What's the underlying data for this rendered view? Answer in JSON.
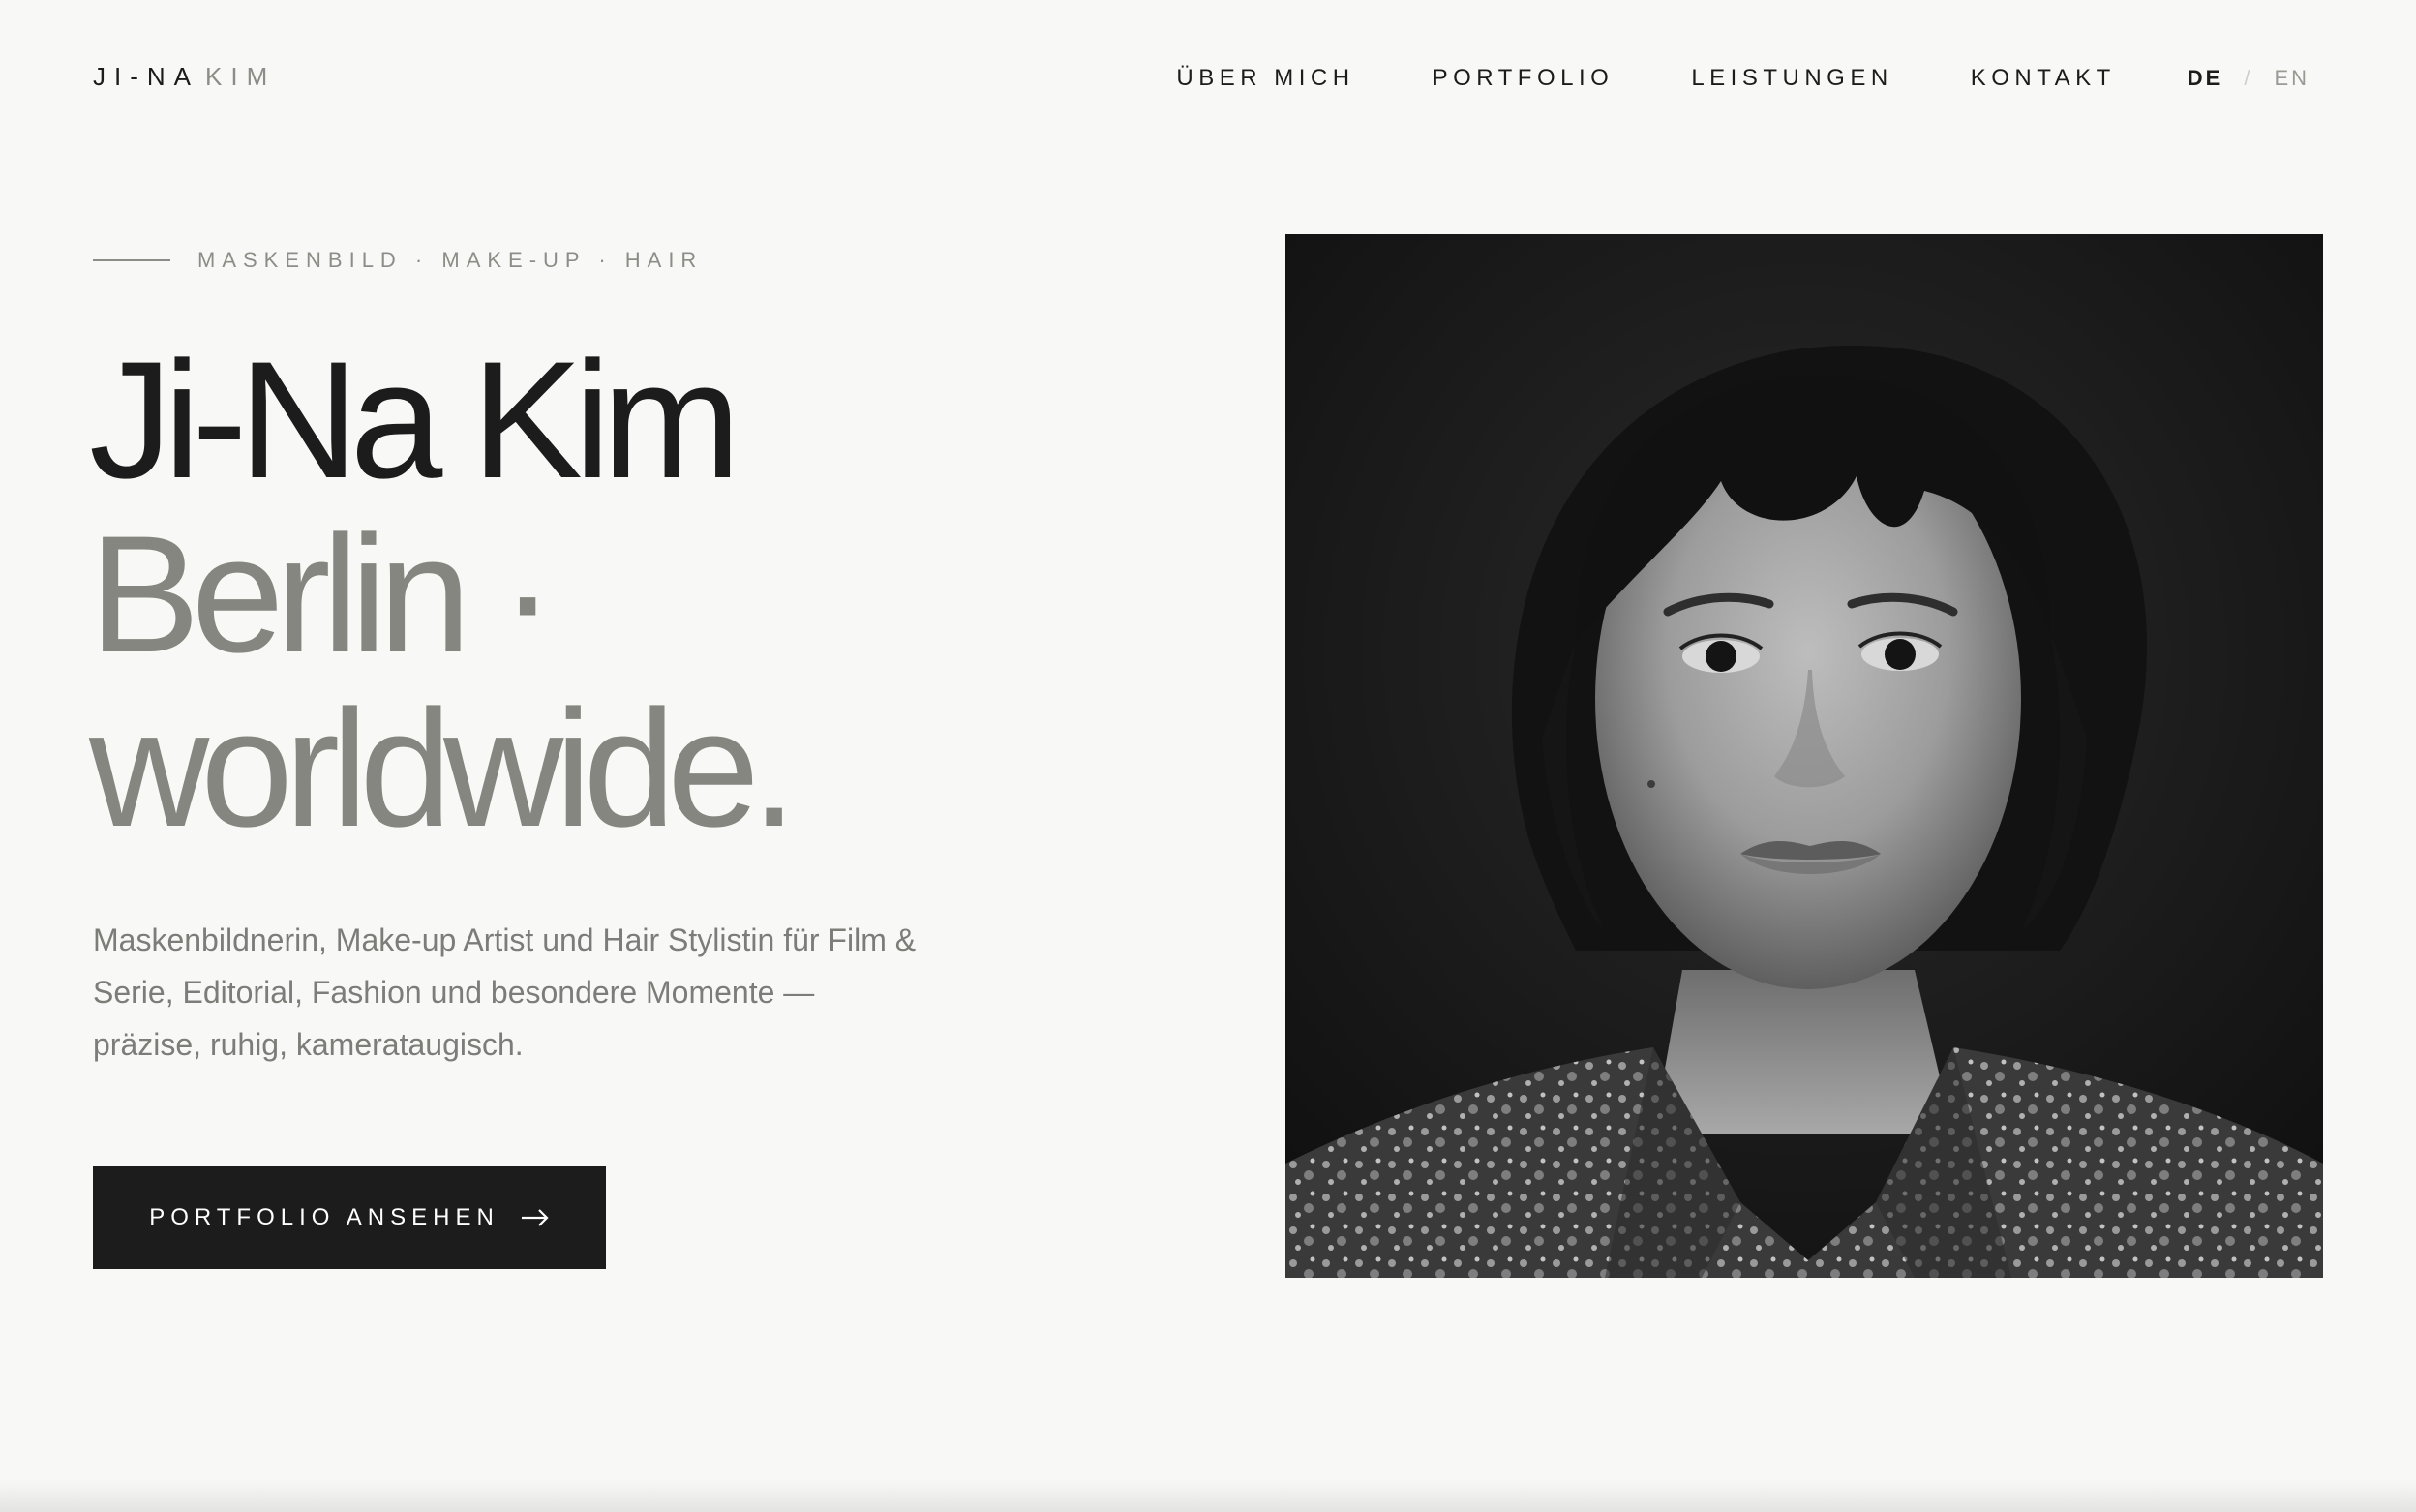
{
  "header": {
    "logo": {
      "first": "JI-NA",
      "last": "KIM"
    },
    "nav": [
      {
        "label": "ÜBER MICH"
      },
      {
        "label": "PORTFOLIO"
      },
      {
        "label": "LEISTUNGEN"
      },
      {
        "label": "KONTAKT"
      }
    ],
    "language": {
      "active": "DE",
      "separator": "/",
      "inactive": "EN"
    }
  },
  "hero": {
    "eyebrow": "MASKENBILD · MAKE-UP · HAIR",
    "headline": {
      "line1": "Ji-Na Kim",
      "line2": "Berlin ·",
      "line3": "worldwide."
    },
    "intro": "Maskenbildnerin, Make-up Artist und Hair Stylistin für Film & Serie, Editorial, Fashion und besondere Momente — präzise, ruhig, kamerataugisch.",
    "cta": {
      "label": "PORTFOLIO ANSEHEN",
      "icon": "arrow-right-icon"
    },
    "portrait": {
      "style": "black-and-white portrait photo"
    }
  },
  "colors": {
    "background": "#f8f8f6",
    "text": "#1c1c1c",
    "muted": "#868680",
    "button": "#1c1c1c"
  }
}
